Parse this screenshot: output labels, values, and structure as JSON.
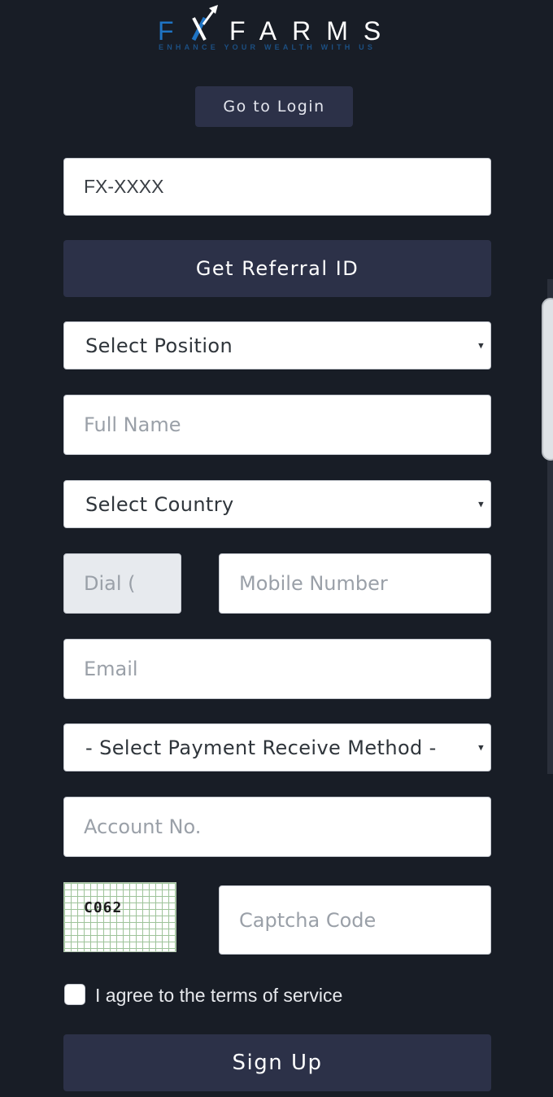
{
  "brand": {
    "logo_letters_left": "F",
    "logo_letters_right": "FARMS",
    "tagline": "ENHANCE YOUR WEALTH WITH US",
    "colors": {
      "accent_blue": "#1f74c4",
      "tagline": "#1c4f82",
      "logo_text": "#ffffff"
    }
  },
  "header": {
    "login_label": "Go to Login"
  },
  "form": {
    "referral_value": "FX-XXXX",
    "referral_button": "Get Referral ID",
    "position_select": "Select Position",
    "full_name_placeholder": "Full Name",
    "country_select": "Select Country",
    "dial_code_placeholder": "Dial (",
    "mobile_placeholder": "Mobile Number",
    "email_placeholder": "Email",
    "payment_select": "- Select Payment Receive Method -",
    "account_placeholder": "Account No.",
    "captcha_image_text": "C062",
    "captcha_placeholder": "Captcha Code",
    "terms_label": "I agree to the terms of service",
    "terms_checked": false,
    "submit_label": "Sign Up"
  },
  "icons": {
    "select_caret": "▾"
  },
  "theme": {
    "background": "#181d26",
    "button_navy": "#2c3148",
    "field_bg": "#ffffff",
    "disabled_field_bg": "#e7eaee"
  }
}
